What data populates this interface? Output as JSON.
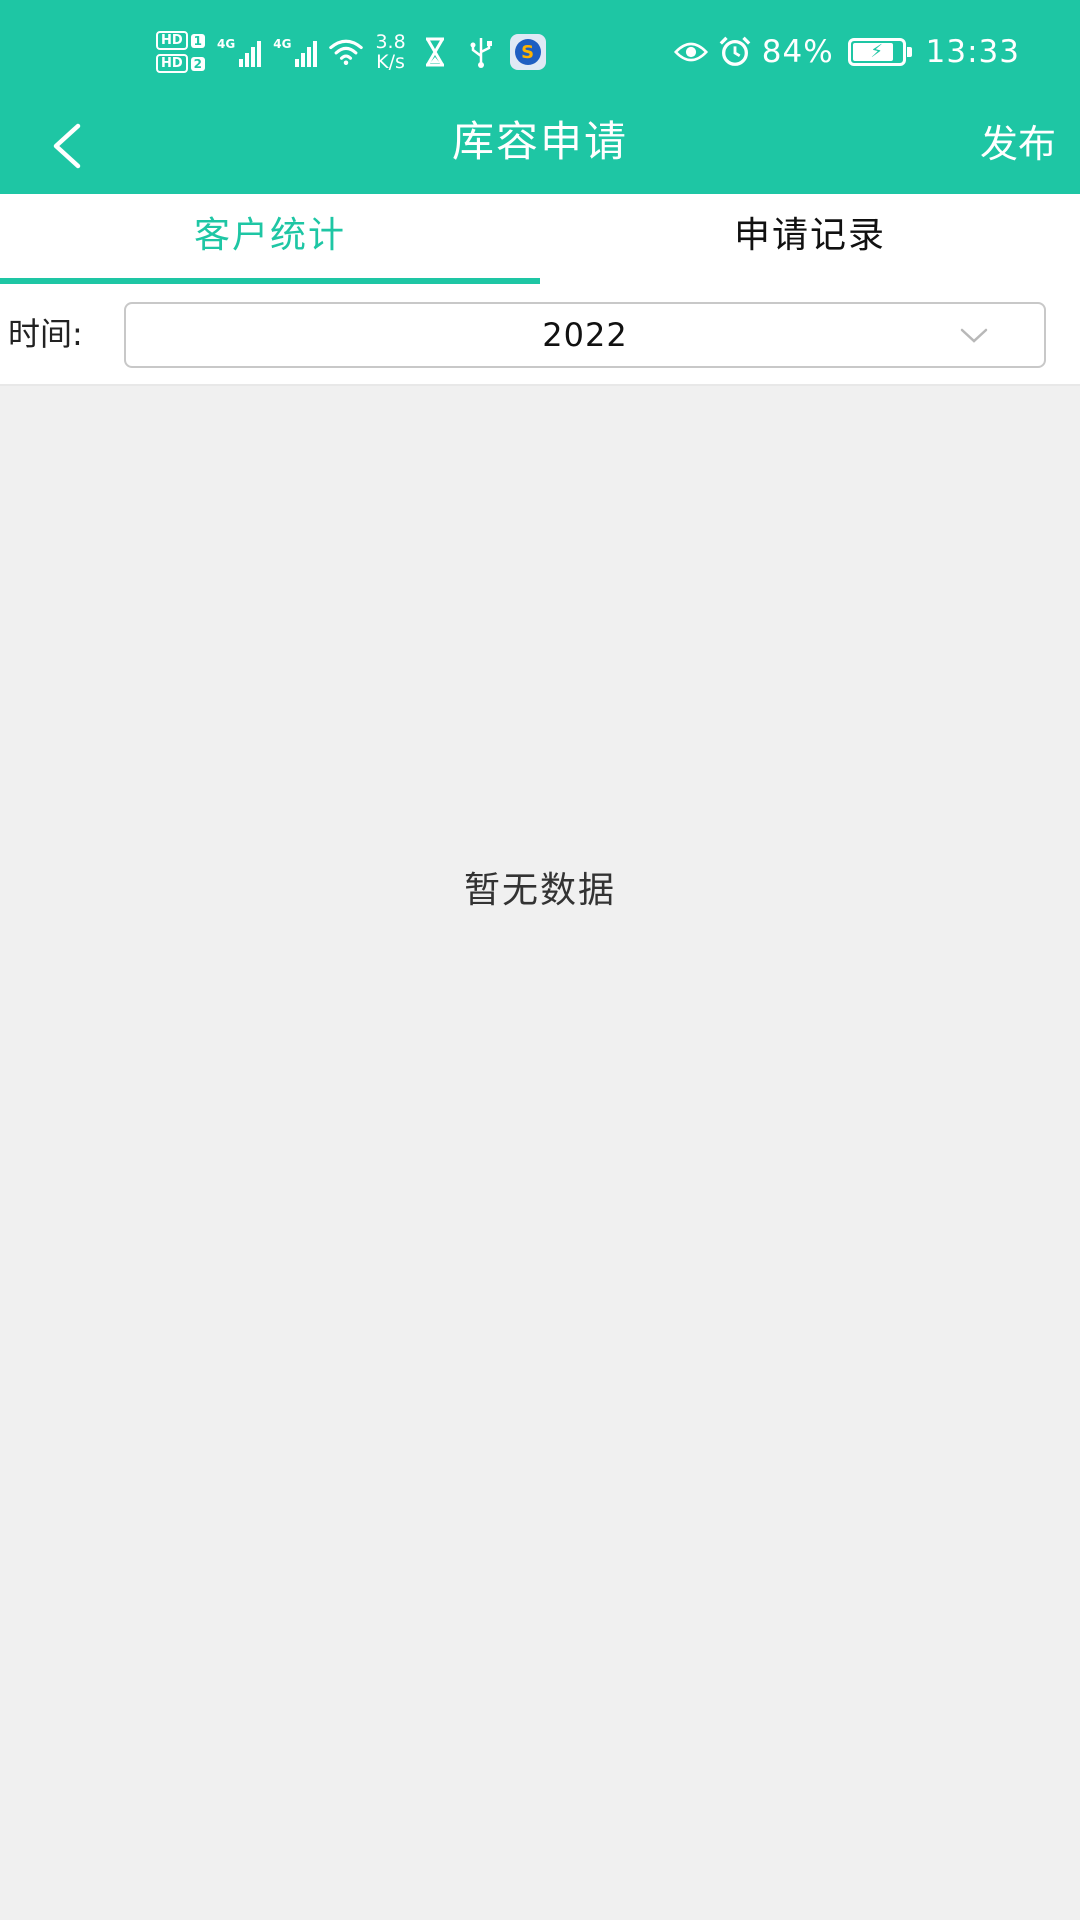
{
  "status_bar": {
    "sim1": {
      "hd": "HD",
      "slot": "1"
    },
    "sim2": {
      "hd": "HD",
      "slot": "2"
    },
    "network_type_1": "4G",
    "network_type_2": "4G",
    "speed_value": "3.8",
    "speed_unit": "K/s",
    "battery_percent": "84%",
    "battery_level": 0.84,
    "time": "13:33",
    "icons": [
      "hd-sim-icon",
      "signal-icon",
      "signal-icon",
      "wifi-icon",
      "hourglass-icon",
      "usb-icon",
      "app-notification-icon",
      "eye-icon",
      "alarm-icon",
      "battery-charging-icon"
    ]
  },
  "nav": {
    "back_icon": "chevron-left-icon",
    "title": "库容申请",
    "action_label": "发布"
  },
  "tabs": [
    {
      "label": "客户统计",
      "active": true
    },
    {
      "label": "申请记录",
      "active": false
    }
  ],
  "filter": {
    "label": "时间:",
    "selected_value": "2022",
    "dropdown_icon": "chevron-down-icon"
  },
  "content": {
    "empty_text": "暂无数据"
  },
  "colors": {
    "accent": "#1ec6a4",
    "background": "#f0f0f0"
  }
}
